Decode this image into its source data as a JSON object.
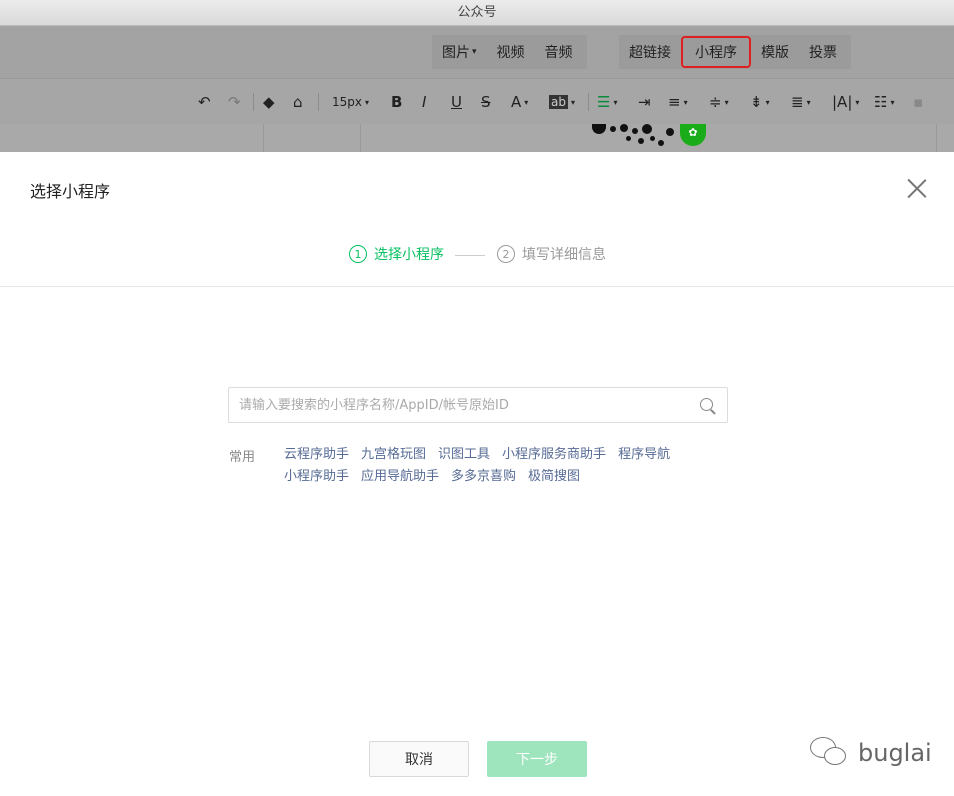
{
  "window": {
    "title": "公众号"
  },
  "insert_toolbar": {
    "group1": [
      "图片",
      "视频",
      "音频"
    ],
    "group2": [
      "超链接",
      "小程序",
      "模版",
      "投票"
    ],
    "highlighted": "小程序"
  },
  "format_toolbar": {
    "font_size": "15px",
    "icons": [
      "undo-icon",
      "redo-icon",
      "format-painter-icon",
      "clear-format-icon",
      "bold-icon",
      "italic-icon",
      "underline-icon",
      "strikethrough-icon",
      "font-color-icon",
      "background-color-icon",
      "align-icon",
      "indent-icon",
      "line-height-icon",
      "paragraph-spacing-icon",
      "list-icon"
    ],
    "bold": "B",
    "italic": "I",
    "underline": "U",
    "strike": "S",
    "font_color": "A",
    "bg_color": "ab"
  },
  "modal": {
    "title": "选择小程序",
    "steps": [
      {
        "num": "1",
        "label": "选择小程序"
      },
      {
        "num": "2",
        "label": "填写详细信息"
      }
    ],
    "search": {
      "placeholder": "请输入要搜索的小程序名称/AppID/帐号原始ID",
      "value": ""
    },
    "common_label": "常用",
    "common_items": [
      "云程序助手",
      "九宫格玩图",
      "识图工具",
      "小程序服务商助手",
      "程序导航",
      "小程序助手",
      "应用导航助手",
      "多多京喜购",
      "极简搜图"
    ],
    "buttons": {
      "cancel": "取消",
      "next": "下一步"
    }
  },
  "watermark": {
    "text": "buglai"
  },
  "colors": {
    "accent": "#07c160",
    "link": "#576b95",
    "next_disabled": "#9ee5bd",
    "highlight_border": "#e02020"
  }
}
